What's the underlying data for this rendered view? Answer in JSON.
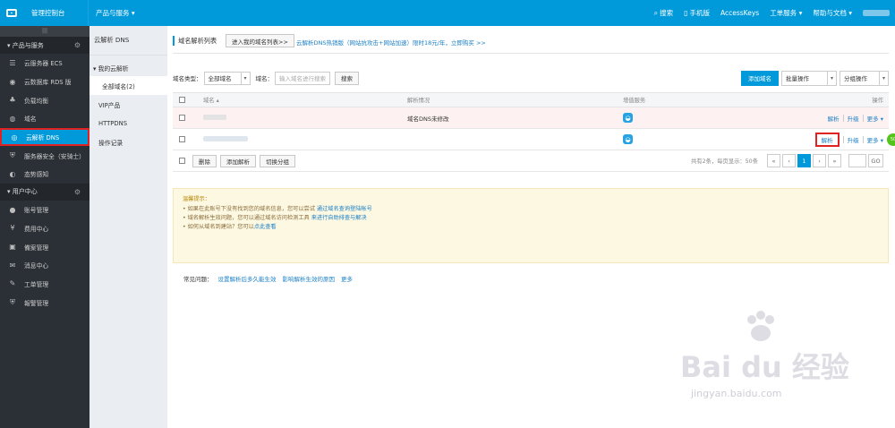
{
  "topbar": {
    "console_title": "管理控制台",
    "products_label": "产品与服务 ▾",
    "search_label": "搜索",
    "mobile_label": "手机版",
    "accesskeys_label": "AccessKeys",
    "ticket_label": "工单服务 ▾",
    "docs_label": "帮助与文档 ▾"
  },
  "sidebar": {
    "toggle": "|||",
    "group_products": "▾ 产品与服务",
    "products": [
      {
        "label": "云服务器 ECS",
        "icon": "server-icon"
      },
      {
        "label": "云数据库 RDS 版",
        "icon": "database-icon"
      },
      {
        "label": "负载均衡",
        "icon": "loadbalancer-icon"
      },
      {
        "label": "域名",
        "icon": "globe-icon"
      },
      {
        "label": "云解析 DNS",
        "icon": "dns-icon"
      },
      {
        "label": "服务器安全（安骑士）",
        "icon": "shield-icon"
      },
      {
        "label": "态势感知",
        "icon": "eye-icon"
      }
    ],
    "group_user": "▾ 用户中心",
    "user": [
      {
        "label": "账号管理",
        "icon": "user-icon"
      },
      {
        "label": "费用中心",
        "icon": "yen-icon"
      },
      {
        "label": "備案管理",
        "icon": "filing-icon"
      },
      {
        "label": "消息中心",
        "icon": "mail-icon"
      },
      {
        "label": "工单管理",
        "icon": "pencil-icon"
      },
      {
        "label": "報警管理",
        "icon": "alert-icon"
      }
    ]
  },
  "submenu": {
    "title": "云解析 DNS",
    "group": "▾ 我的云解析",
    "all_domains": "全部域名(2)",
    "vip": "VIP产品",
    "httpdns": "HTTPDNS",
    "logs": "操作记录"
  },
  "main": {
    "tab_title": "域名解析列表",
    "enter_button": "进入我的域名列表>>",
    "promo": "云解析DNS热销版（网站抗攻击+网站加速）限时18元/年，立即购买 >>",
    "filter": {
      "type_label": "域名类型：",
      "type_value": "全部域名",
      "domain_label": "域名：",
      "search_placeholder": "输入域名进行搜索",
      "search_button": "搜索",
      "add_button": "添加域名",
      "batch_label": "批量操作",
      "group_label": "分组操作"
    },
    "table": {
      "col_domain": "域名 ▴",
      "col_status": "解析情况",
      "col_value": "增值服务",
      "col_ops": "操作",
      "rows": [
        {
          "status": "域名DNS未修改",
          "op_resolve": "解析",
          "op_upgrade": "升级",
          "op_more": "更多 ▾"
        },
        {
          "status": "",
          "op_resolve": "解析",
          "op_upgrade": "升级",
          "op_more": "更多 ▾"
        }
      ]
    },
    "footer": {
      "delete_button": "删除",
      "add_resolve_button": "添加解析",
      "switch_group_button": "切换分组",
      "summary": "共有2条，每页显示：50条",
      "first": "«",
      "prev": "‹",
      "page": "1",
      "next": "›",
      "last": "»",
      "go": "GO"
    },
    "tips": {
      "title": "温馨提示：",
      "line1_text": "• 如果在此账号下没有找到您的域名信息，您可以尝试 ",
      "line1_link": "通过域名查询登陆帐号",
      "line2_text": "• 域名解析生效问题，您可以通过域名访问检测工具 ",
      "line2_link": "来进行自助排查与解决",
      "line3_text": "• 如何从域名到建站？您可以",
      "line3_link": "点此查看"
    },
    "faq": {
      "label": "常见问题：",
      "q1": "设置解析后多久能生效",
      "q2": "影响解析生效的原因",
      "q3": "更多"
    }
  },
  "watermark": {
    "text": "Bai du 经验",
    "url": "jingyan.baidu.com"
  },
  "colors": {
    "brand": "#0099da",
    "sidebar_bg": "#2b3036",
    "highlight": "#e02222"
  }
}
